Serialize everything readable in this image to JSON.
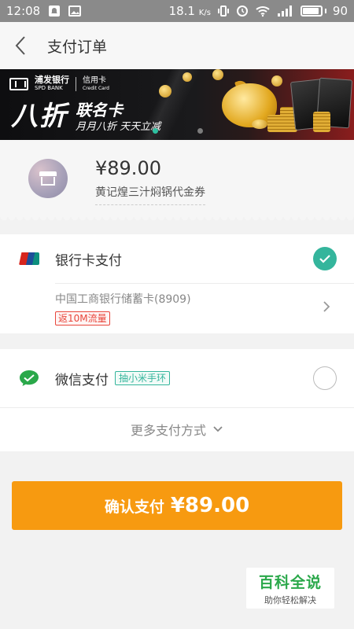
{
  "status_bar": {
    "time": "12:08",
    "speed": "18.1",
    "speed_unit": "K/s",
    "battery": "90"
  },
  "nav": {
    "title": "支付订单"
  },
  "banner": {
    "bank_name_cn": "浦发银行",
    "bank_name_en": "SPD BANK",
    "card_cn": "信用卡",
    "card_en": "Credit Card",
    "promo_big": "八折",
    "promo_name": "联名卡",
    "promo_sub": "月月八折 天天立减",
    "active_dot": 0,
    "dot_count": 2
  },
  "order": {
    "amount": "¥89.00",
    "description": "黄记煌三汁焖锅代金券"
  },
  "payment": {
    "bank_card": {
      "label": "银行卡支付",
      "selected": true,
      "card_name": "中国工商银行储蓄卡(8909)",
      "tag": "返10M流量"
    },
    "wechat": {
      "label": "微信支付",
      "tag": "抽小米手环",
      "selected": false
    },
    "more_label": "更多支付方式"
  },
  "confirm": {
    "label": "确认支付",
    "amount": "¥89.00"
  },
  "watermark": {
    "title": "百科全说",
    "subtitle": "助你轻松解决"
  },
  "colors": {
    "accent_green": "#34b59c",
    "confirm_orange": "#f79a10",
    "tag_red": "#e8463c"
  }
}
